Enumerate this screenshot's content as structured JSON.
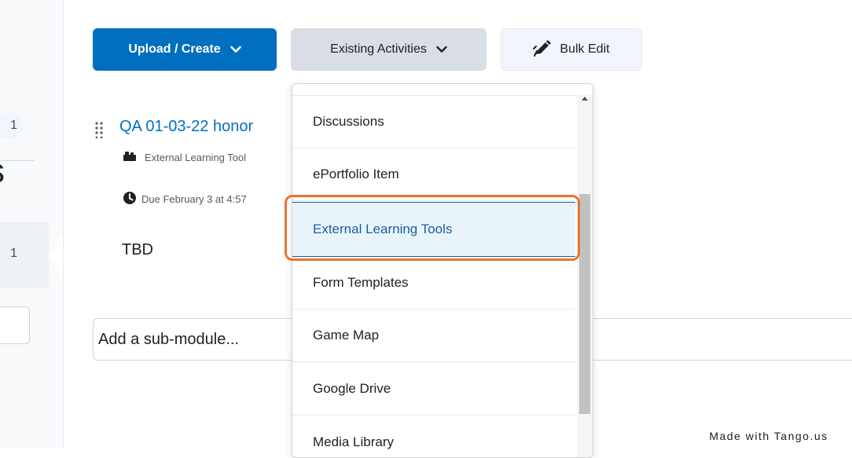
{
  "toolbar": {
    "upload_label": "Upload / Create",
    "existing_label": "Existing Activities",
    "bulk_label": "Bulk Edit"
  },
  "left_strip": {
    "badge_1": "1",
    "badge_2": "1",
    "partial_letter": "s"
  },
  "topic": {
    "title": "QA 01-03-22 honor",
    "type_label": "External Learning Tool",
    "due_label": "Due February 3 at 4:57",
    "description": "TBD"
  },
  "submodule": {
    "placeholder": "Add a sub-module..."
  },
  "dropdown": {
    "items": [
      {
        "label": "Discussions"
      },
      {
        "label": "ePortfolio Item"
      },
      {
        "label": "External Learning Tools"
      },
      {
        "label": "Form Templates"
      },
      {
        "label": "Game Map"
      },
      {
        "label": "Google Drive"
      },
      {
        "label": "Media Library"
      }
    ],
    "highlighted": "External Learning Tools"
  },
  "watermark": "Made with Tango.us",
  "colors": {
    "primary": "#006fbf",
    "highlight_ring": "#e8742f",
    "highlight_bg": "#e8f4fa",
    "secondary_button": "#d9dee4"
  },
  "icons": {
    "upload_chevron": "chevron-down-icon",
    "existing_chevron": "chevron-down-icon",
    "bulk_edit": "pencil-edit-icon",
    "drag": "drag-handle-icon",
    "tool": "puzzle-tool-icon",
    "due": "clock-icon"
  }
}
